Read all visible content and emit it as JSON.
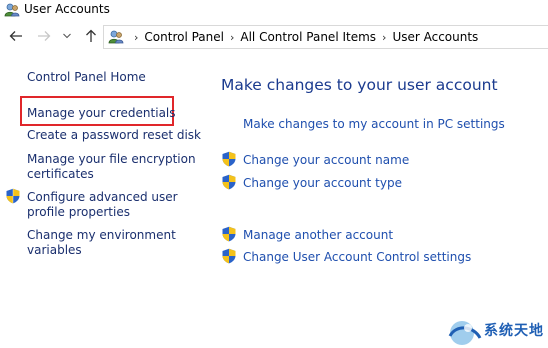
{
  "window": {
    "title": "User Accounts",
    "icon": "users-icon"
  },
  "navigation": {
    "back_icon": "back-arrow-icon",
    "forward_icon": "forward-arrow-icon",
    "recent_icon": "chevron-down-icon",
    "up_icon": "up-arrow-icon",
    "breadcrumb": [
      "Control Panel",
      "All Control Panel Items",
      "User Accounts"
    ]
  },
  "left_pane": {
    "items": [
      {
        "label": "Control Panel Home",
        "shield": false
      },
      {
        "label": "Manage your credentials",
        "shield": false,
        "highlighted": true
      },
      {
        "label": "Create a password reset disk",
        "shield": false
      },
      {
        "label_line1": "Manage your file encryption",
        "label_line2": "certificates",
        "shield": false
      },
      {
        "label_line1": "Configure advanced user",
        "label_line2": "profile properties",
        "shield": true
      },
      {
        "label_line1": "Change my environment",
        "label_line2": "variables",
        "shield": false
      }
    ]
  },
  "main": {
    "heading": "Make changes to your user account",
    "links": [
      {
        "label": "Make changes to my account in PC settings",
        "shield": false
      },
      {
        "label": "Change your account name",
        "shield": true
      },
      {
        "label": "Change your account type",
        "shield": true
      },
      {
        "label": "Manage another account",
        "shield": true
      },
      {
        "label": "Change User Account Control settings",
        "shield": true
      }
    ]
  },
  "watermark": {
    "text": "系统天地"
  },
  "colors": {
    "link": "#1f4fae",
    "left_link": "#1a2f6e",
    "heading": "#1b3b8f",
    "highlight_border": "#e0262a"
  }
}
